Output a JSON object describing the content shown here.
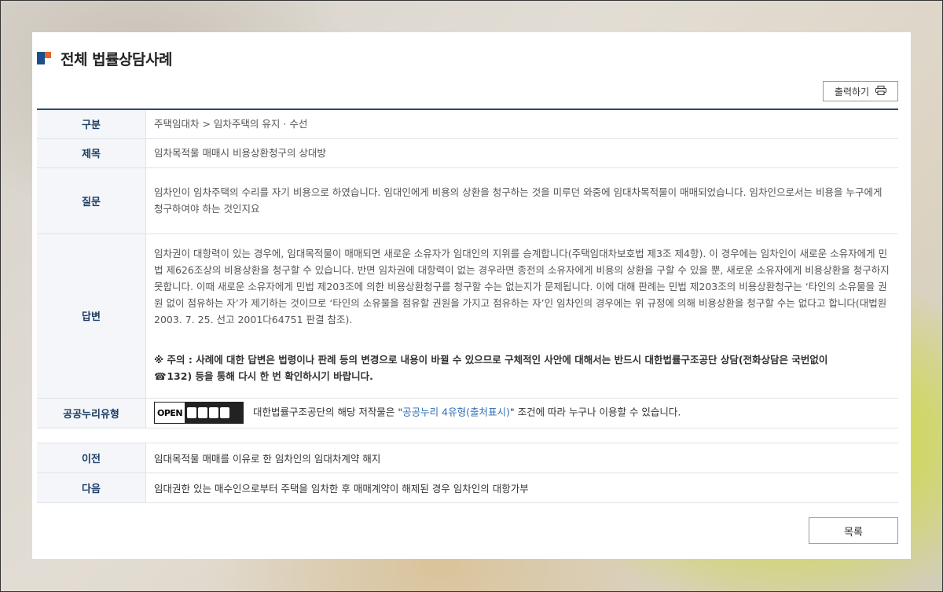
{
  "page_title": "전체 법률상담사례",
  "print_button": {
    "label": "출력하기",
    "icon": "printer-icon"
  },
  "rows": {
    "category": {
      "label": "구분",
      "value": "주택임대차 > 임차주택의 유지 · 수선"
    },
    "subject": {
      "label": "제목",
      "value": "임차목적물 매매시 비용상환청구의 상대방"
    },
    "question": {
      "label": "질문",
      "value": "임차인이 임차주택의 수리를 자기 비용으로 하였습니다. 임대인에게 비용의 상환을 청구하는 것을 미루던 와중에 임대차목적물이 매매되었습니다. 임차인으로서는 비용을 누구에게 청구하여야 하는 것인지요"
    },
    "answer": {
      "label": "답변",
      "value": "임차권이 대항력이 있는 경우에, 임대목적물이 매매되면 새로운 소유자가 임대인의 지위를 승계합니다(주택임대차보호법 제3조 제4항). 이 경우에는 임차인이 새로운 소유자에게 민법 제626조상의 비용상환을 청구할 수 있습니다. 반면 임차권에 대항력이 없는 경우라면 종전의 소유자에게 비용의 상환을 구할 수 있을 뿐, 새로운 소유자에게 비용상환을 청구하지 못합니다. 이때 새로운 소유자에게 민법 제203조에 의한 비용상환청구를 청구할 수는 없는지가 문제됩니다. 이에 대해 판례는 민법 제203조의 비용상환청구는 ‘타인의 소유물을 권원 없이 점유하는 자’가 제기하는 것이므로 ‘타인의 소유물을 점유할 권원을 가지고 점유하는 자’인 임차인의 경우에는 위 규정에 의해 비용상환을 청구할 수는 없다고 합니다(대법원 2003. 7. 25. 선고 2001다64751 판결 참조).",
      "notice_part1": "※ 주의 : 사례에 대한 답변은 법령이나 판례 등의 변경으로 내용이 바뀔 수 있으므로 구체적인 사안에 대해서는 반드시 대한법률구조공단 상담(전화상담은 국번없이",
      "notice_phone_icon": "☎",
      "notice_part2": "132) 등을 통해 다시 한 번 확인하시기 바랍니다."
    },
    "license": {
      "label": "공공누리유형",
      "badge_text": "OPEN",
      "text_before": "대한법률구조공단의 해당 저작물은 \"",
      "link_text": "공공누리 4유형(출처표시)",
      "text_after": "\" 조건에 따라 누구나 이용할 수 있습니다."
    }
  },
  "navigation": {
    "prev": {
      "label": "이전",
      "value": "임대목적물 매매를 이유로 한 임차인의 임대차계약 해지"
    },
    "next": {
      "label": "다음",
      "value": "임대권한 있는 매수인으로부터 주택을 임차한 후 매매계약이 해제된 경우 임차인의 대항가부"
    }
  },
  "list_button": {
    "label": "목록"
  }
}
